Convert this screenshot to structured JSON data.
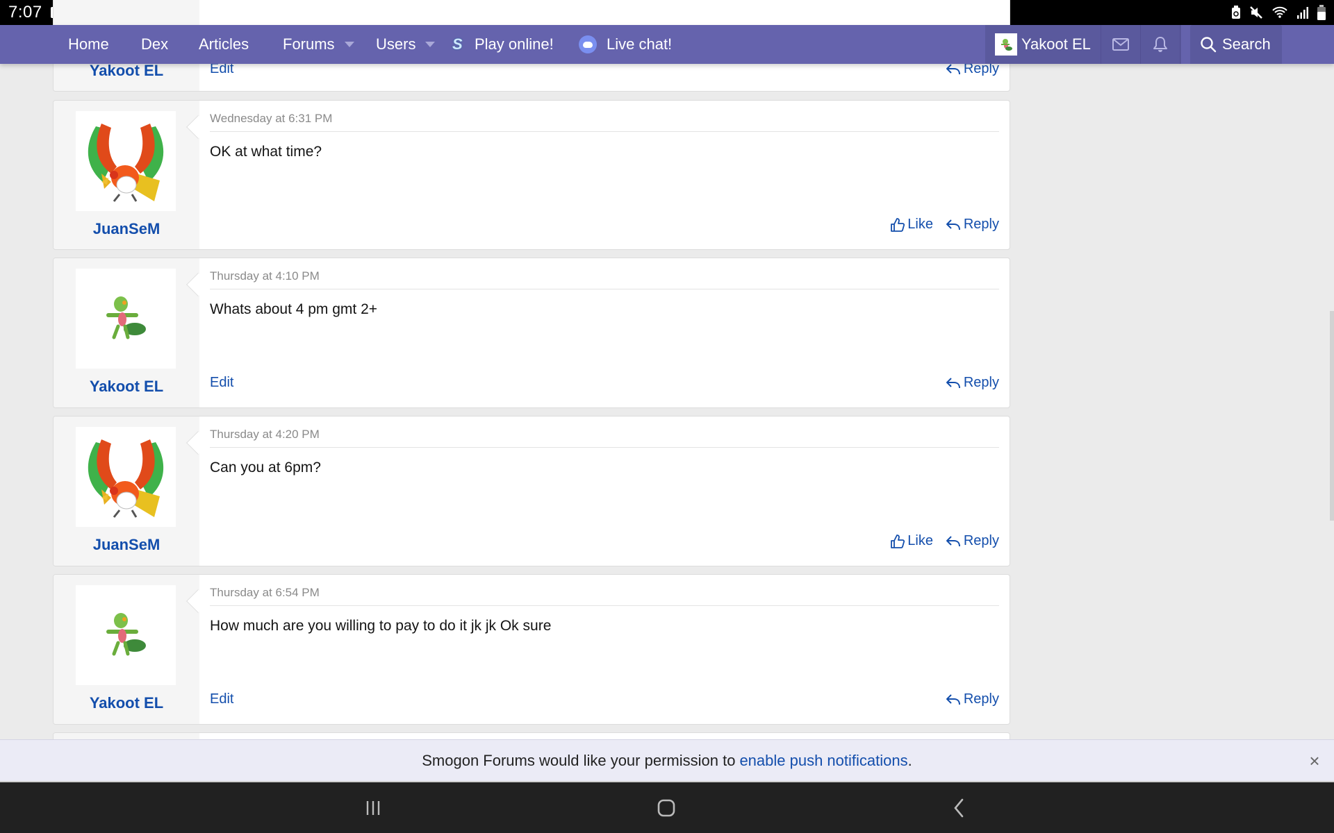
{
  "status_bar": {
    "time": "7:07",
    "left_icons": [
      "gallery-icon",
      "youtube-icon",
      "youtube-icon",
      "dot-icon"
    ],
    "right_icons": [
      "battery-saver-icon",
      "mute-icon",
      "wifi-icon",
      "signal-icon",
      "battery-icon"
    ]
  },
  "nav": {
    "items": [
      {
        "label": "Home"
      },
      {
        "label": "Dex"
      },
      {
        "label": "Articles"
      },
      {
        "label": "Forums",
        "has_dropdown": true
      },
      {
        "label": "Users",
        "has_dropdown": true
      },
      {
        "label": "Play online!",
        "icon": "showdown-icon"
      },
      {
        "label": "Live chat!",
        "icon": "discord-icon"
      }
    ],
    "user": {
      "name": "Yakoot EL"
    },
    "inbox_icon": "envelope-icon",
    "alerts_icon": "bell-icon",
    "search": {
      "label": "Search",
      "icon": "search-icon"
    }
  },
  "posts": [
    {
      "author": "Yakoot EL",
      "avatar": "treecko",
      "timestamp": "",
      "text": "",
      "actions": {
        "edit": "Edit",
        "reply": "Reply"
      },
      "partial": true
    },
    {
      "author": "JuanSeM",
      "avatar": "ho-oh",
      "timestamp": "Wednesday at 6:31 PM",
      "text": "OK at what time?",
      "actions": {
        "like": "Like",
        "reply": "Reply"
      }
    },
    {
      "author": "Yakoot EL",
      "avatar": "treecko",
      "timestamp": "Thursday at 4:10 PM",
      "text": "Whats about 4 pm gmt 2+",
      "actions": {
        "edit": "Edit",
        "reply": "Reply"
      }
    },
    {
      "author": "JuanSeM",
      "avatar": "ho-oh",
      "timestamp": "Thursday at 4:20 PM",
      "text": "Can you at 6pm?",
      "actions": {
        "like": "Like",
        "reply": "Reply"
      }
    },
    {
      "author": "Yakoot EL",
      "avatar": "treecko",
      "timestamp": "Thursday at 6:54 PM",
      "text": "How much are you willing to pay to do it jk jk Ok sure",
      "actions": {
        "edit": "Edit",
        "reply": "Reply"
      }
    }
  ],
  "push_banner": {
    "text": "Smogon Forums would like your permission to",
    "link": "enable push notifications",
    "suffix": ".",
    "close": "×"
  },
  "android_nav": {
    "buttons": [
      "recent-apps-icon",
      "home-icon",
      "back-icon"
    ]
  },
  "colors": {
    "nav_bg": "#6563ad",
    "nav_user_bg": "#5a599d",
    "link": "#134eac",
    "page_bg": "#ebebeb",
    "banner_bg": "#ebebf6"
  }
}
